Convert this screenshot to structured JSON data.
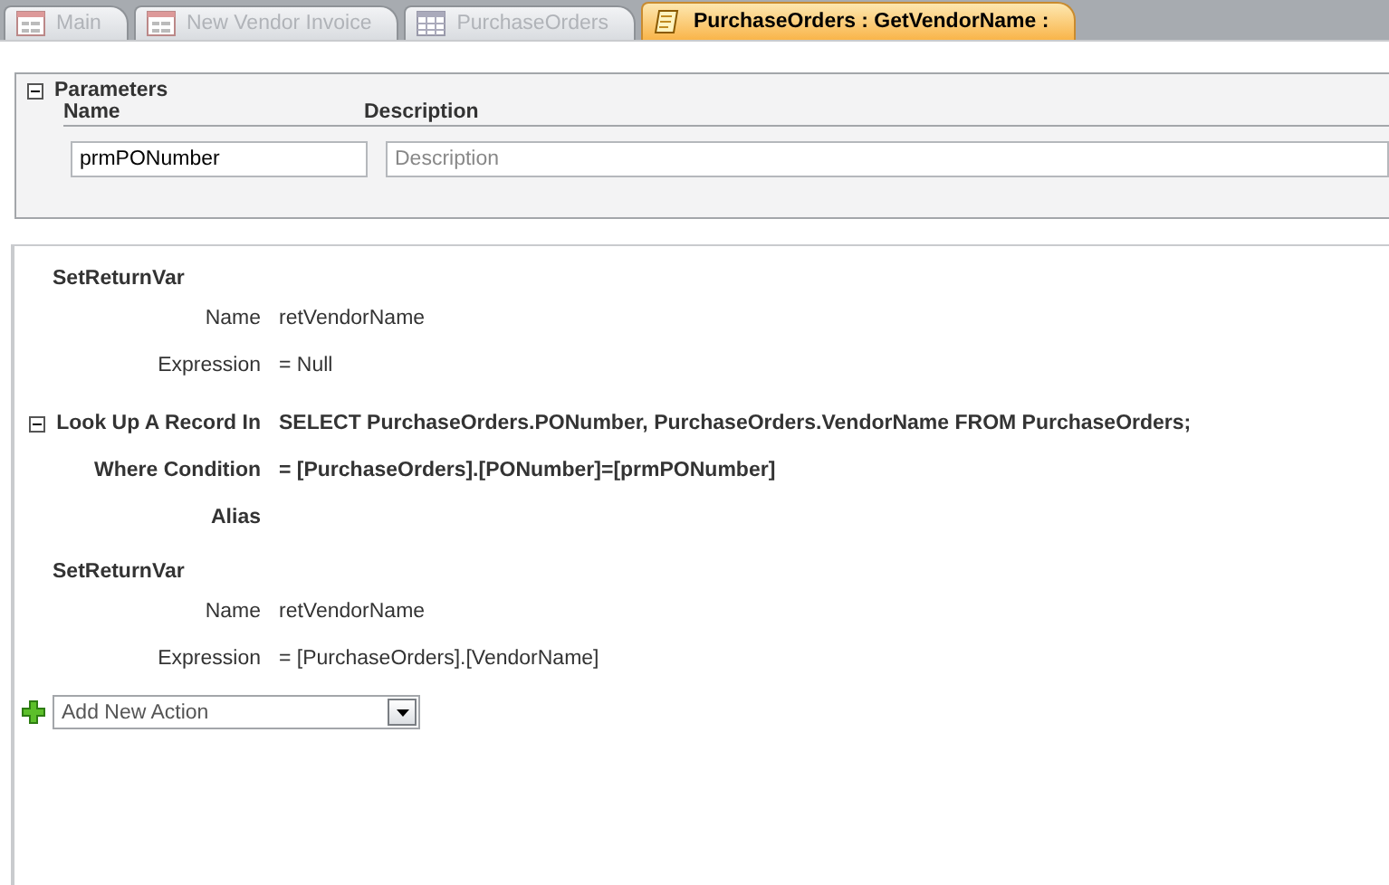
{
  "tabs": [
    {
      "label": "Main",
      "kind": "form",
      "selected": false
    },
    {
      "label": "New Vendor Invoice",
      "kind": "form",
      "selected": false
    },
    {
      "label": "PurchaseOrders",
      "kind": "table",
      "selected": false
    },
    {
      "label": "PurchaseOrders : GetVendorName :",
      "kind": "macro",
      "selected": true
    }
  ],
  "parameters": {
    "title": "Parameters",
    "expanded": true,
    "columns": [
      "Name",
      "Description"
    ],
    "rows": [
      {
        "name": "prmPONumber",
        "description_placeholder": "Description"
      }
    ]
  },
  "actions": [
    {
      "kind": "action",
      "name": "SetReturnVar",
      "arguments": [
        {
          "label": "Name",
          "value": "retVendorName"
        },
        {
          "label": "Expression",
          "value": "= Null"
        }
      ]
    },
    {
      "kind": "block",
      "name": "Look Up A Record In",
      "value": "SELECT PurchaseOrders.PONumber, PurchaseOrders.VendorName FROM PurchaseOrders;",
      "expanded": true,
      "arguments": [
        {
          "label": "Where Condition",
          "value": "= [PurchaseOrders].[PONumber]=[prmPONumber]"
        },
        {
          "label": "Alias"
        }
      ]
    },
    {
      "kind": "action",
      "name": "SetReturnVar",
      "arguments": [
        {
          "label": "Name",
          "value": "retVendorName"
        },
        {
          "label": "Expression",
          "value": "= [PurchaseOrders].[VendorName]"
        }
      ]
    }
  ],
  "add_action": {
    "placeholder": "Add New Action"
  }
}
